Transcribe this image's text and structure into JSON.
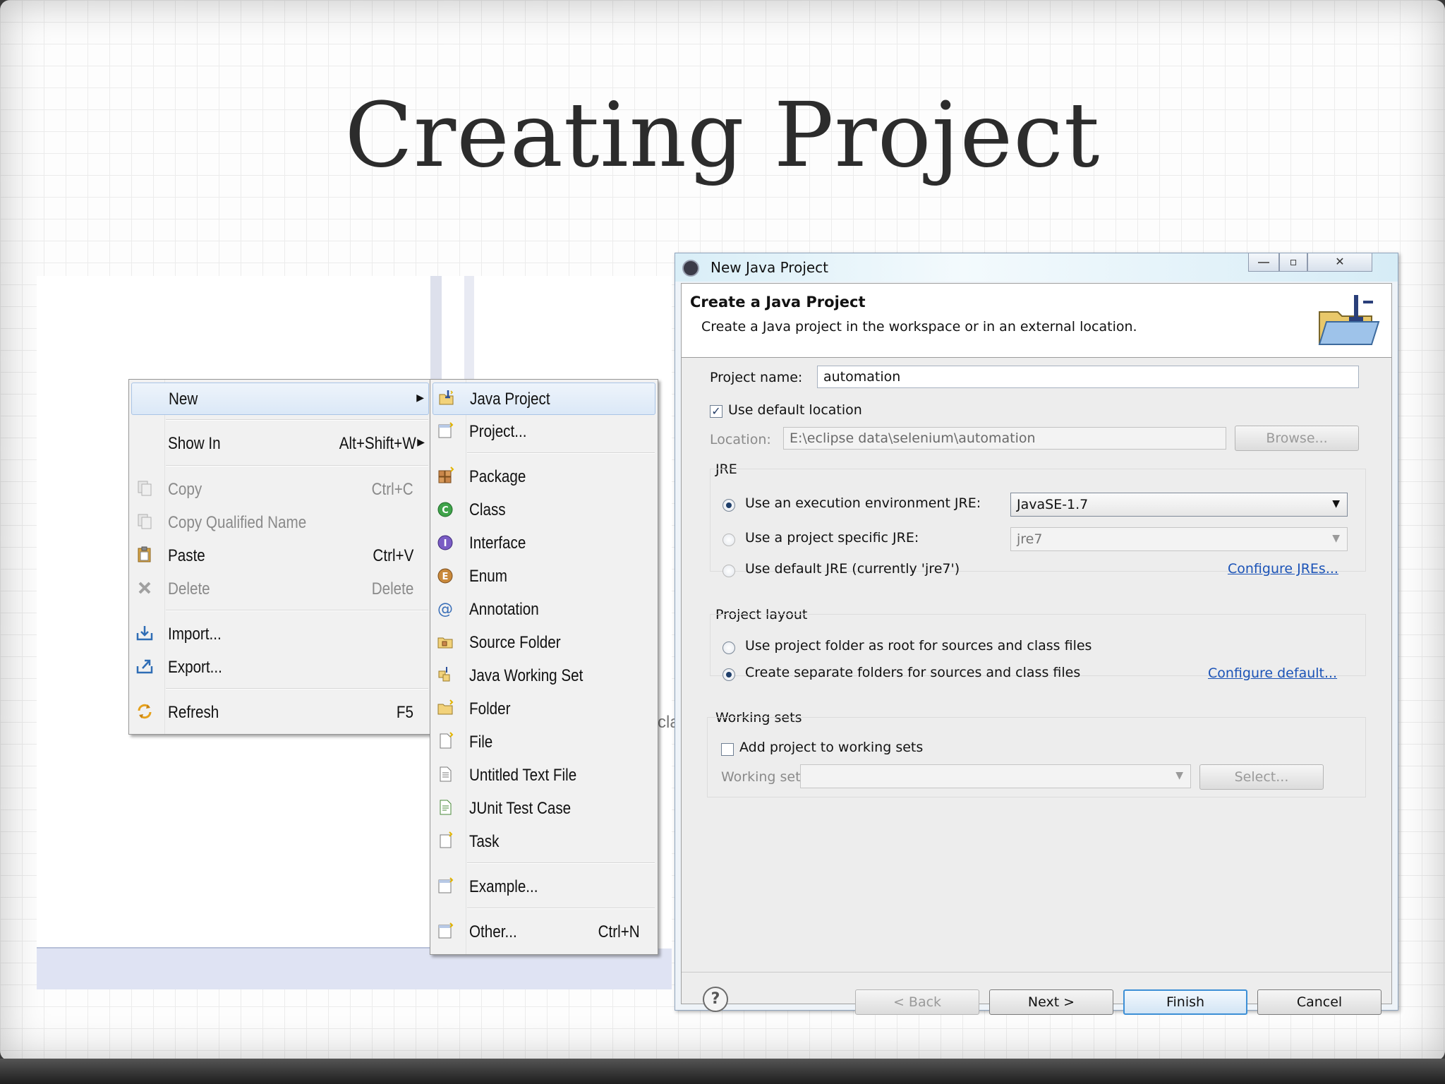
{
  "slide": {
    "title": "Creating Project"
  },
  "background": {
    "peek_text": "cla"
  },
  "context_menu": {
    "items": [
      {
        "label": "New",
        "accel": "",
        "submenu": true,
        "disabled": false,
        "icon": "none"
      },
      {
        "label": "Show In",
        "accel": "Alt+Shift+W",
        "submenu": true,
        "disabled": false,
        "icon": "none"
      },
      {
        "label": "Copy",
        "accel": "Ctrl+C",
        "disabled": true,
        "icon": "copy-icon"
      },
      {
        "label": "Copy Qualified Name",
        "accel": "",
        "disabled": true,
        "icon": "copy-qualified-name-icon"
      },
      {
        "label": "Paste",
        "accel": "Ctrl+V",
        "disabled": false,
        "icon": "paste-icon"
      },
      {
        "label": "Delete",
        "accel": "Delete",
        "disabled": true,
        "icon": "delete-icon"
      },
      {
        "label": "Import...",
        "accel": "",
        "disabled": false,
        "icon": "import-icon"
      },
      {
        "label": "Export...",
        "accel": "",
        "disabled": false,
        "icon": "export-icon"
      },
      {
        "label": "Refresh",
        "accel": "F5",
        "disabled": false,
        "icon": "refresh-icon"
      }
    ]
  },
  "new_submenu": {
    "items": [
      {
        "label": "Java Project",
        "accel": "",
        "icon": "java-project-icon"
      },
      {
        "label": "Project...",
        "accel": "",
        "icon": "project-icon"
      },
      {
        "label": "Package",
        "accel": "",
        "icon": "package-icon"
      },
      {
        "label": "Class",
        "accel": "",
        "icon": "class-icon"
      },
      {
        "label": "Interface",
        "accel": "",
        "icon": "interface-icon"
      },
      {
        "label": "Enum",
        "accel": "",
        "icon": "enum-icon"
      },
      {
        "label": "Annotation",
        "accel": "",
        "icon": "annotation-icon"
      },
      {
        "label": "Source Folder",
        "accel": "",
        "icon": "source-folder-icon"
      },
      {
        "label": "Java Working Set",
        "accel": "",
        "icon": "java-working-set-icon"
      },
      {
        "label": "Folder",
        "accel": "",
        "icon": "folder-icon"
      },
      {
        "label": "File",
        "accel": "",
        "icon": "file-icon"
      },
      {
        "label": "Untitled Text File",
        "accel": "",
        "icon": "untitled-text-file-icon"
      },
      {
        "label": "JUnit Test Case",
        "accel": "",
        "icon": "junit-test-case-icon"
      },
      {
        "label": "Task",
        "accel": "",
        "icon": "task-icon"
      },
      {
        "label": "Example...",
        "accel": "",
        "icon": "example-icon"
      },
      {
        "label": "Other...",
        "accel": "Ctrl+N",
        "icon": "other-icon"
      }
    ]
  },
  "dialog": {
    "window_title": "New Java Project",
    "header_title": "Create a Java Project",
    "header_desc": "Create a Java project in the workspace or in an external location.",
    "project_name_label": "Project name:",
    "project_name_value": "automation",
    "use_default_location_label": "Use default location",
    "use_default_location_checked": true,
    "location_label": "Location:",
    "location_value": "E:\\eclipse data\\selenium\\automation",
    "browse_label": "Browse...",
    "jre_group_label": "JRE",
    "jre_option1_label": "Use an execution environment JRE:",
    "jre_option1_value": "JavaSE-1.7",
    "jre_option2_label": "Use a project specific JRE:",
    "jre_option2_value": "jre7",
    "jre_option3_label": "Use default JRE (currently 'jre7')",
    "configure_jres_link": "Configure JREs...",
    "layout_group_label": "Project layout",
    "layout_option1_label": "Use project folder as root for sources and class files",
    "layout_option2_label": "Create separate folders for sources and class files",
    "configure_default_link": "Configure default...",
    "working_sets_group_label": "Working sets",
    "add_to_working_sets_label": "Add project to working sets",
    "working_sets_label": "Working sets:",
    "select_label": "Select...",
    "back_label": "< Back",
    "next_label": "Next >",
    "finish_label": "Finish",
    "cancel_label": "Cancel",
    "help_symbol": "?",
    "restore_symbol": "▫",
    "close_symbol": "✕"
  }
}
